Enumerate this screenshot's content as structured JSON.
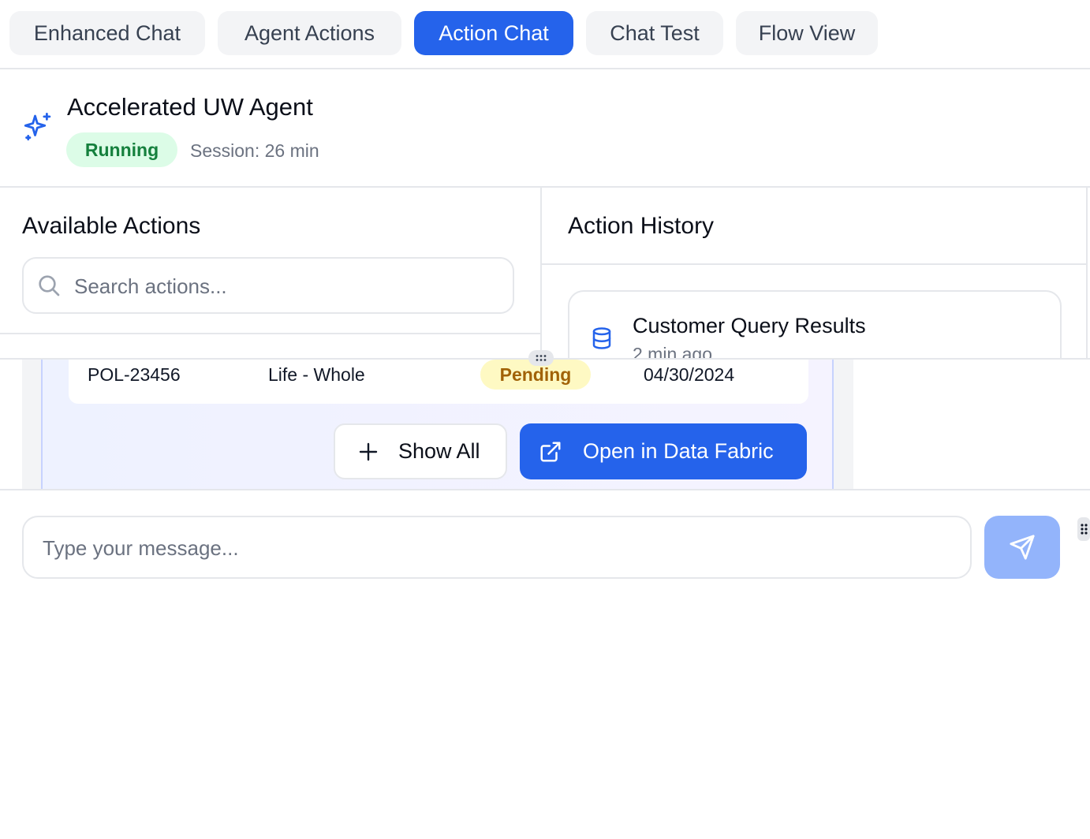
{
  "tabs": [
    {
      "label": "Enhanced Chat",
      "active": false
    },
    {
      "label": "Agent Actions",
      "active": false
    },
    {
      "label": "Action Chat",
      "active": true
    },
    {
      "label": "Chat Test",
      "active": false
    },
    {
      "label": "Flow View",
      "active": false
    }
  ],
  "agent": {
    "name": "Accelerated UW Agent",
    "status": "Running",
    "session": "Session: 26 min",
    "icon": "sparkles-icon"
  },
  "available_actions": {
    "title": "Available Actions",
    "search_placeholder": "Search actions..."
  },
  "action_history": {
    "title": "Action History",
    "items": [
      {
        "title": "Customer Query Results",
        "time": "2 min ago",
        "icon": "database-icon"
      }
    ]
  },
  "results_table": {
    "rows": [
      {
        "policy": "POL-23456",
        "type": "Life - Whole",
        "status": "Pending",
        "date": "04/30/2024"
      }
    ]
  },
  "buttons": {
    "show_all": "Show All",
    "open_fabric": "Open in Data Fabric"
  },
  "composer": {
    "placeholder": "Type your message..."
  },
  "colors": {
    "accent": "#2563eb",
    "running_bg": "#dcfce7",
    "running_text": "#15803d",
    "pending_bg": "#fef9c3",
    "pending_text": "#a16207",
    "send_disabled": "#93b4fb"
  }
}
